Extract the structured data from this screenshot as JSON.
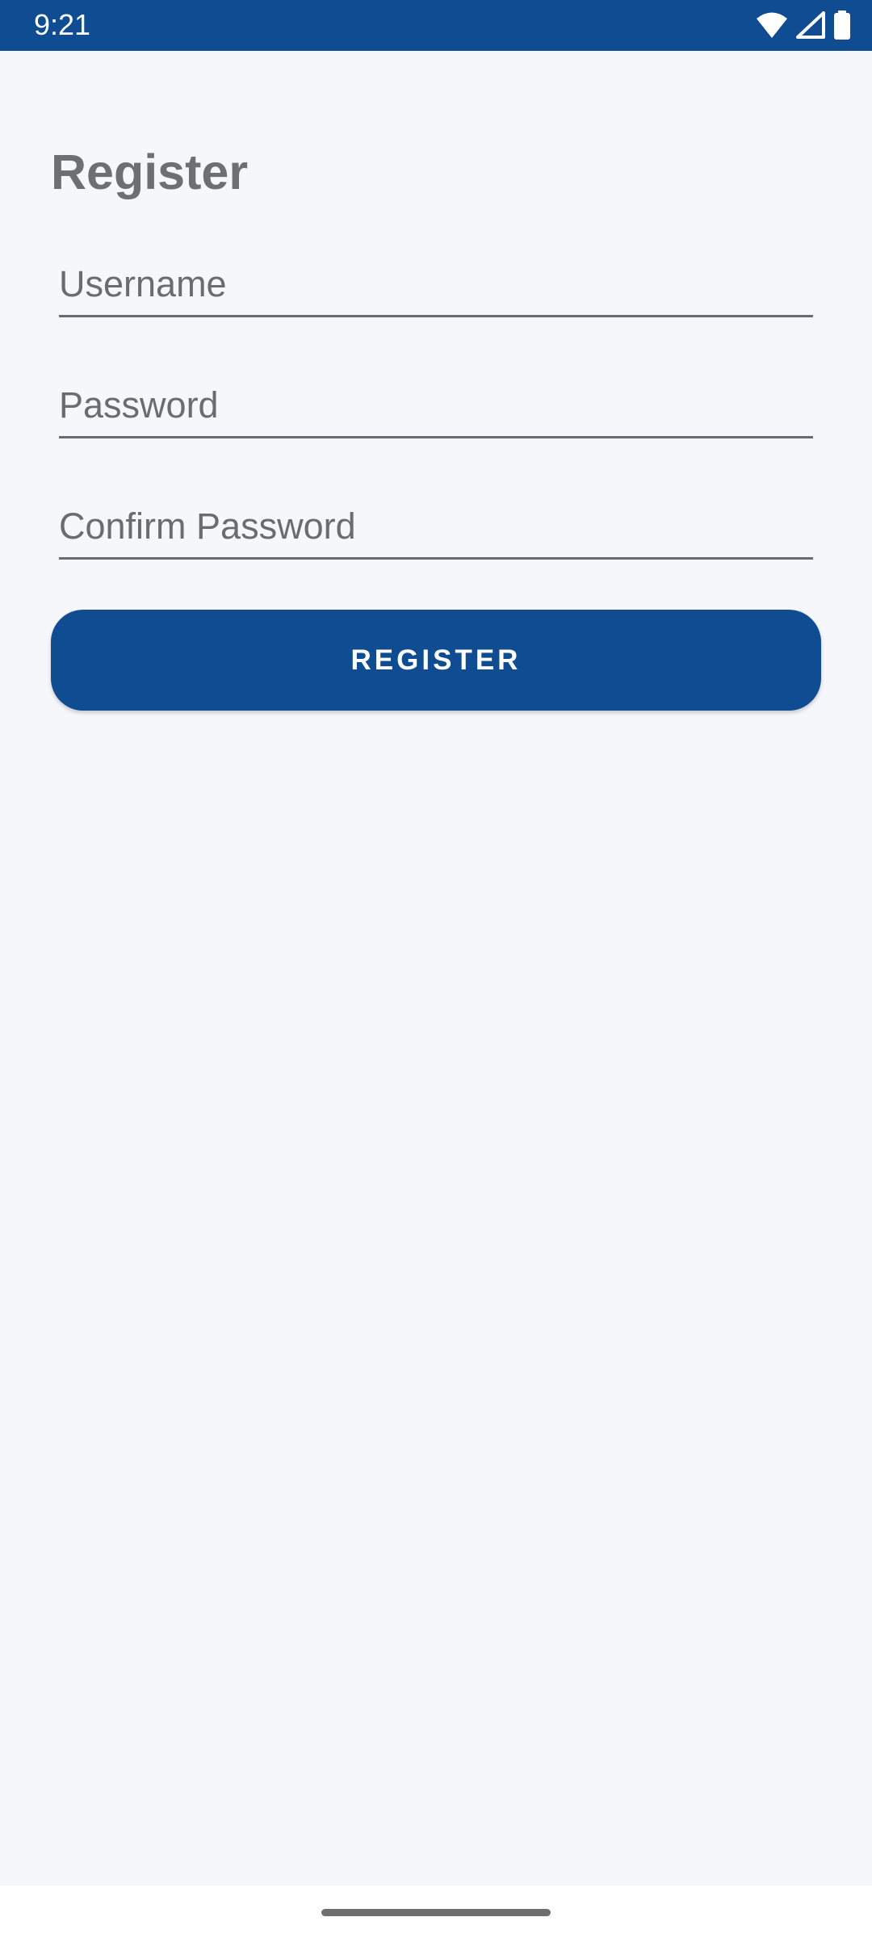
{
  "colors": {
    "primary": "#0f4c92",
    "background": "#f6f7fb",
    "title_text": "#6e6f72",
    "underline": "#6a6b70"
  },
  "status_bar": {
    "time": "9:21",
    "icons": [
      "wifi-icon",
      "signal-icon",
      "battery-icon"
    ]
  },
  "page": {
    "title": "Register"
  },
  "form": {
    "username_placeholder": "Username",
    "password_placeholder": "Password",
    "confirm_password_placeholder": "Confirm Password",
    "register_label": "REGISTER"
  }
}
